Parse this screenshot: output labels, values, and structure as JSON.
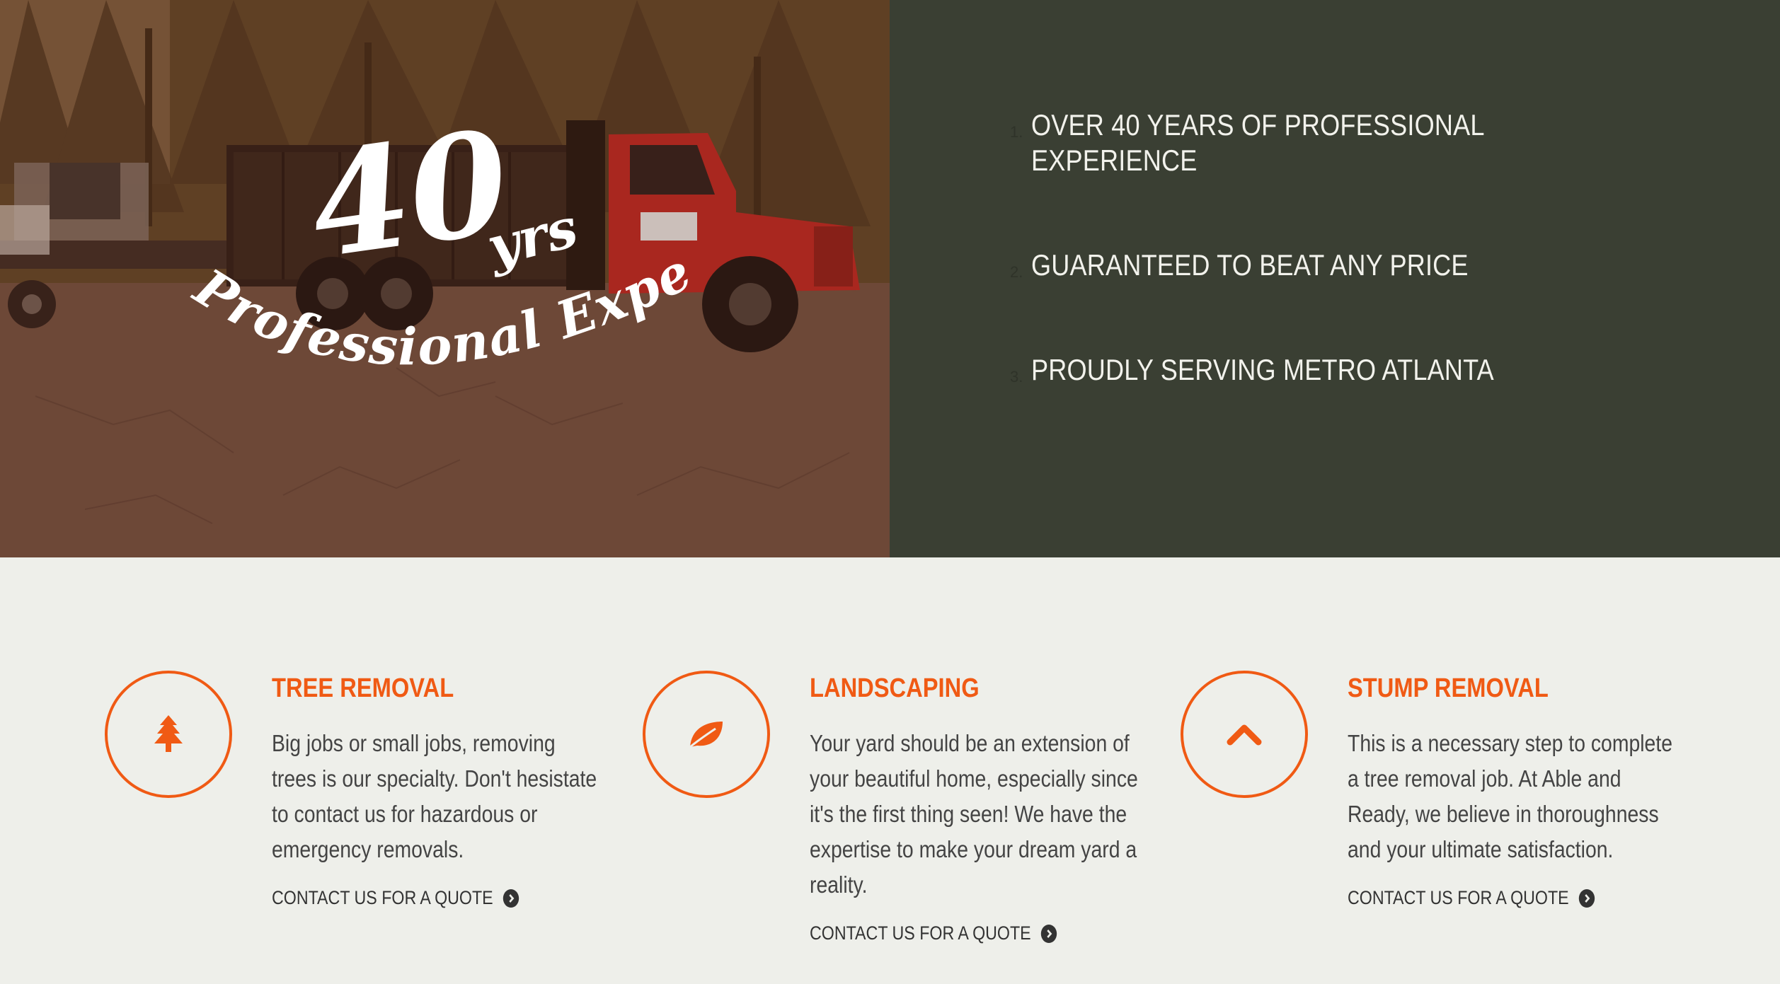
{
  "hero": {
    "badge_main": "40",
    "badge_unit": "yrs",
    "badge_subtitle": "Professional Experience",
    "features": [
      {
        "num": "1.",
        "text": "OVER 40 YEARS OF PROFESSIONAL EXPERIENCE"
      },
      {
        "num": "2.",
        "text": "GUARANTEED TO BEAT ANY PRICE"
      },
      {
        "num": "3.",
        "text": "PROUDLY SERVING METRO ATLANTA"
      }
    ]
  },
  "services": [
    {
      "icon": "tree-icon",
      "title": "TREE REMOVAL",
      "description": "Big jobs or small jobs, removing trees is our specialty. Don't hesistate to contact us for hazardous or emergency removals.",
      "cta": "CONTACT US FOR A QUOTE"
    },
    {
      "icon": "leaf-icon",
      "title": "LANDSCAPING",
      "description": "Your yard should be an extension of your beautiful home, especially since it's the first thing seen! We have the expertise to make your dream yard a reality.",
      "cta": "CONTACT US FOR A QUOTE"
    },
    {
      "icon": "chevron-up-icon",
      "title": "STUMP REMOVAL",
      "description": "This is a necessary step to complete a tree removal job. At Able and Ready, we believe in thoroughness and your ultimate satisfaction.",
      "cta": "CONTACT US FOR A QUOTE"
    }
  ],
  "colors": {
    "accent": "#f05a14",
    "panel": "#3a3f33",
    "background": "#eeefea"
  }
}
